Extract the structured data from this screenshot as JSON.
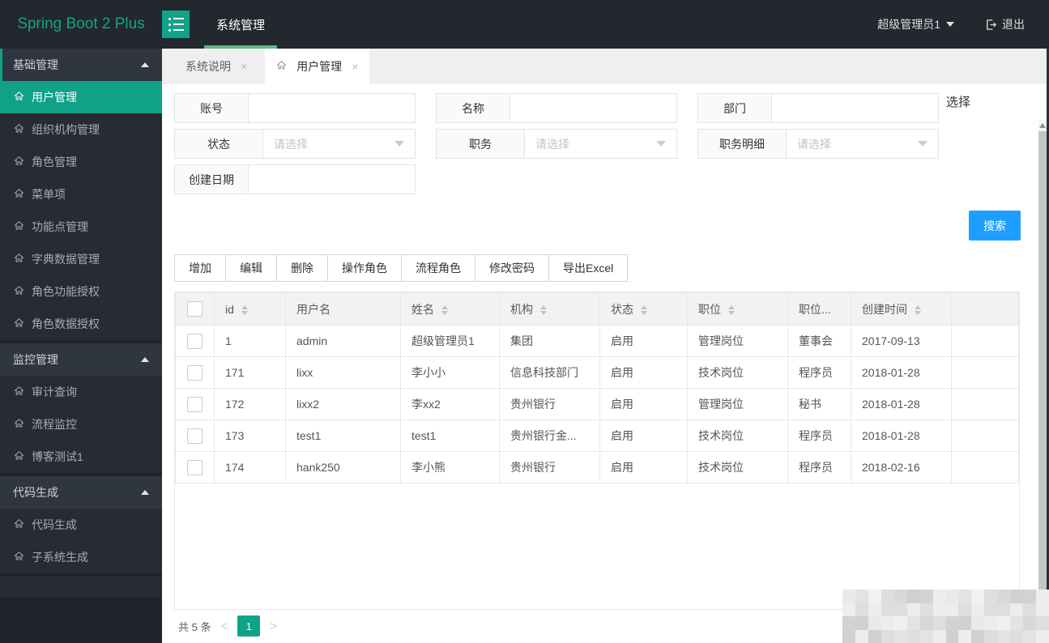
{
  "header": {
    "logo": "Spring Boot 2 Plus",
    "nav_items": [
      {
        "label": "系统管理",
        "active": true
      }
    ],
    "user_name": "超级管理员1",
    "logout_label": "退出"
  },
  "sidebar": {
    "sections": [
      {
        "title": "基础管理",
        "expanded": true,
        "active": true,
        "items": [
          {
            "label": "用户管理",
            "active": true
          },
          {
            "label": "组织机构管理"
          },
          {
            "label": "角色管理"
          },
          {
            "label": "菜单项"
          },
          {
            "label": "功能点管理"
          },
          {
            "label": "字典数据管理"
          },
          {
            "label": "角色功能授权"
          },
          {
            "label": "角色数据授权"
          }
        ]
      },
      {
        "title": "监控管理",
        "expanded": true,
        "items": [
          {
            "label": "审计查询"
          },
          {
            "label": "流程监控"
          },
          {
            "label": "博客测试1"
          }
        ]
      },
      {
        "title": "代码生成",
        "expanded": true,
        "items": [
          {
            "label": "代码生成"
          },
          {
            "label": "子系统生成"
          }
        ]
      }
    ]
  },
  "tabs": [
    {
      "label": "系统说明",
      "active": false
    },
    {
      "label": "用户管理",
      "active": true
    }
  ],
  "search_form": {
    "fields": [
      {
        "label": "账号",
        "type": "text",
        "value": ""
      },
      {
        "label": "名称",
        "type": "text",
        "value": ""
      },
      {
        "label": "部门",
        "type": "text",
        "value": ""
      },
      {
        "label": "状态",
        "type": "select",
        "placeholder": "请选择"
      },
      {
        "label": "职务",
        "type": "select",
        "placeholder": "请选择"
      },
      {
        "label": "职务明细",
        "type": "select",
        "placeholder": "请选择"
      },
      {
        "label": "创建日期",
        "type": "text",
        "value": ""
      }
    ],
    "choose_link": "选择",
    "search_button": "搜索"
  },
  "toolbar": {
    "buttons": [
      "增加",
      "编辑",
      "删除",
      "操作角色",
      "流程角色",
      "修改密码",
      "导出Excel"
    ]
  },
  "table": {
    "columns": [
      {
        "label": "",
        "type": "checkbox"
      },
      {
        "label": "id",
        "sortable": true
      },
      {
        "label": "用户名",
        "sortable": false
      },
      {
        "label": "姓名",
        "sortable": true
      },
      {
        "label": "机构",
        "sortable": true
      },
      {
        "label": "状态",
        "sortable": true
      },
      {
        "label": "职位",
        "sortable": true
      },
      {
        "label": "职位...",
        "sortable": false
      },
      {
        "label": "创建时间",
        "sortable": true
      },
      {
        "label": "",
        "type": "empty"
      }
    ],
    "row_keys": [
      "id",
      "username",
      "name",
      "org",
      "status",
      "post",
      "post_detail",
      "created_at"
    ],
    "rows": [
      {
        "id": "1",
        "username": "admin",
        "name": "超级管理员1",
        "org": "集团",
        "status": "启用",
        "post": "管理岗位",
        "post_detail": "董事会",
        "created_at": "2017-09-13"
      },
      {
        "id": "171",
        "username": "lixx",
        "name": "李小小",
        "org": "信息科技部门",
        "status": "启用",
        "post": "技术岗位",
        "post_detail": "程序员",
        "created_at": "2018-01-28"
      },
      {
        "id": "172",
        "username": "lixx2",
        "name": "李xx2",
        "org": "贵州银行",
        "status": "启用",
        "post": "管理岗位",
        "post_detail": "秘书",
        "created_at": "2018-01-28"
      },
      {
        "id": "173",
        "username": "test1",
        "name": "test1",
        "org": "贵州银行金...",
        "status": "启用",
        "post": "技术岗位",
        "post_detail": "程序员",
        "created_at": "2018-01-28"
      },
      {
        "id": "174",
        "username": "hank250",
        "name": "李小熊",
        "org": "贵州银行",
        "status": "启用",
        "post": "技术岗位",
        "post_detail": "程序员",
        "created_at": "2018-02-16"
      }
    ]
  },
  "pagination": {
    "total_text": "共 5 条",
    "prev": "<",
    "pages": [
      {
        "label": "1",
        "active": true
      }
    ],
    "next": ">"
  },
  "colors": {
    "accent_teal": "#0fa287",
    "header_bg": "#23272e",
    "nav_underline": "#5db878",
    "search_button_blue": "#1e9fff"
  }
}
